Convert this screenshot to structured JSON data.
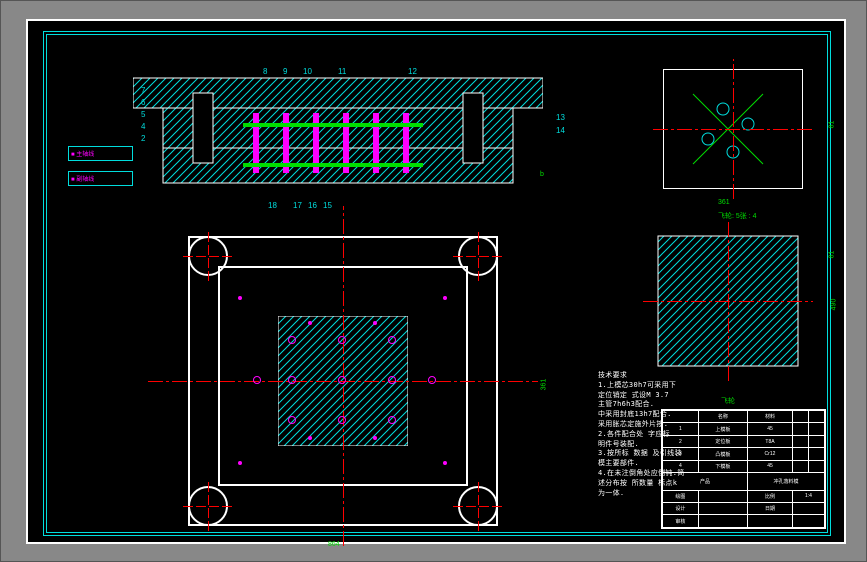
{
  "callouts": {
    "c2": "2",
    "c4": "4",
    "c5": "5",
    "c6": "6",
    "c7": "7",
    "c8": "8",
    "c9": "9",
    "c10": "10",
    "c11": "11",
    "c12": "12",
    "c13": "13",
    "c14": "14",
    "c15": "15",
    "c16": "16",
    "c17": "17",
    "c18": "18"
  },
  "aux": {
    "text1": "■ 主轴线",
    "text2": "■ 副轴线"
  },
  "notes": {
    "header": "技术要求",
    "l1": "1.上模芯30h7可采用下",
    "l2": "定位销定 式设M 3.7",
    "l3": "主管7h6h3配合.",
    "l4": "中采用封底13h7配合.",
    "l5": "采用胀芯定施外片按.",
    "l6": "2.各件配合处 字应标",
    "l7": "明件号装配.",
    "l8": "3.按所标 数据 及引线装",
    "l9": "模主要部件.",
    "l10": "4.在未注倒角处应倒钝.简",
    "l11": "述分布按 所数量 标点k",
    "l12": "为一体."
  },
  "detail_labels": {
    "d1_label": "飞轮: 5张 : 4",
    "d2_label": "飞轮"
  },
  "titleblock": {
    "r1c2": "名称",
    "r1c3": "材料",
    "r2c1": "1",
    "r2c2": "上模板",
    "r2c3": "45",
    "r3c1": "2",
    "r3c2": "定位板",
    "r3c3": "T8A",
    "r4c1": "3",
    "r4c2": "凸模板",
    "r4c3": "Cr12",
    "r5c1": "4",
    "r5c2": "下模板",
    "r5c3": "45",
    "proj_label": "产品",
    "proj_val": "冲孔落料模",
    "scale_label": "比例",
    "scale_val": "1:4",
    "drawn_label": "绘图",
    "date_label": "日期",
    "check_label": "设计",
    "appr_label": "审核"
  },
  "dimensions": {
    "plan_w": "864",
    "plan_h": "361",
    "detail1_w": "361",
    "detail1_h": "81",
    "detail2_w": "81",
    "detail2_h": "490",
    "section_v": "b"
  }
}
